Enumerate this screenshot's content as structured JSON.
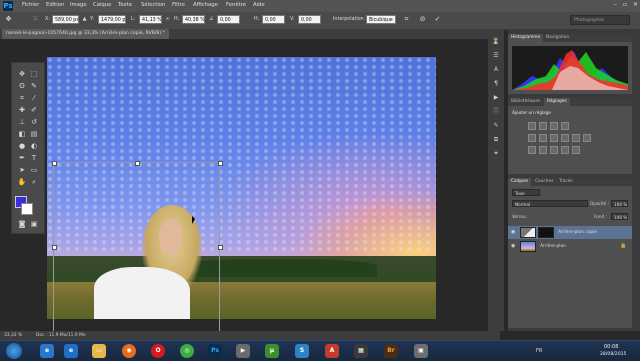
{
  "app": {
    "logo": "Ps",
    "window_controls": [
      "–",
      "▫",
      "✕"
    ]
  },
  "menu": [
    "Fichier",
    "Edition",
    "Image",
    "Calque",
    "Texte",
    "Sélection",
    "Filtre",
    "Affichage",
    "Fenêtre",
    "Aide"
  ],
  "options_bar": {
    "x_label": "X:",
    "x_value": "589,00 px",
    "y_label": "Y:",
    "y_value": "1479,00 px",
    "l_label": "L:",
    "l_value": "41,13 %",
    "h_label": "H:",
    "h_value": "40,38 %",
    "angle_value": "0,00",
    "hs_label": "H:",
    "hs_value": "0,00",
    "vs_label": "V:",
    "vs_value": "0,00",
    "interp_label": "Interpolation :",
    "interp_value": "Bicubique",
    "search_placeholder": "Photographie"
  },
  "document": {
    "tab_title": "nansel-le-pagoon-1057640.jpg @ 33,3% (Arrière-plan copie, RVB/8) *"
  },
  "status_bar": {
    "zoom": "33,33 %",
    "doc_info": "Doc : 11,9 Mo/11,9 Mo"
  },
  "panels": {
    "histogram": {
      "tabs": [
        "Histogramme",
        "Navigation"
      ]
    },
    "adjustments": {
      "tabs": [
        "Bibliothèques",
        "Réglages"
      ],
      "title": "Ajouter un réglage"
    },
    "layers": {
      "tabs": [
        "Calques",
        "Couches",
        "Tracés"
      ],
      "kind_filter": "Type",
      "blend_mode": "Normal",
      "opacity_label": "Opacité :",
      "opacity_value": "100 %",
      "lock_label": "Verrou :",
      "fill_label": "Fond :",
      "fill_value": "100 %",
      "rows": [
        {
          "name": "Arrière-plan copie",
          "selected": true
        },
        {
          "name": "Arrière-plan",
          "selected": false
        }
      ]
    }
  },
  "taskbar": {
    "lang": "FR",
    "time": "00:08",
    "date": "28/08/2015"
  },
  "colors": {
    "foreground": "#3a2fe0",
    "background": "#ffffff",
    "ui_dark": "#282828"
  }
}
